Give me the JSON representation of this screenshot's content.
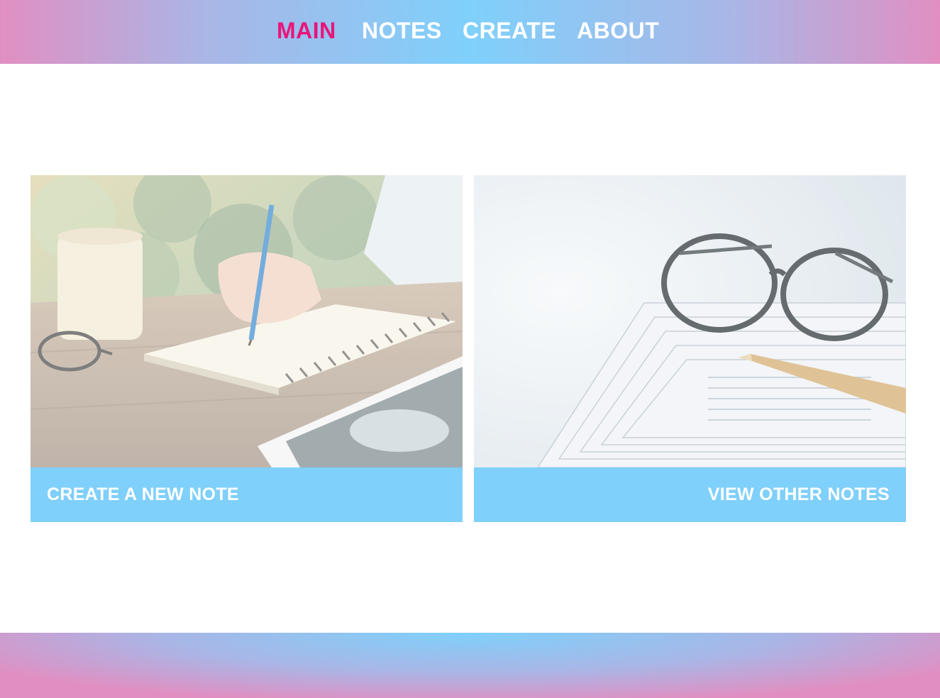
{
  "nav": {
    "items": [
      {
        "label": "MAIN",
        "active": true
      },
      {
        "label": "NOTES",
        "active": false
      },
      {
        "label": "CREATE",
        "active": false
      },
      {
        "label": "ABOUT",
        "active": false
      }
    ],
    "active_color": "#e8157a"
  },
  "cards": [
    {
      "label": "CREATE A NEW NOTE",
      "image": "writing-notebook-photo"
    },
    {
      "label": "VIEW OTHER NOTES",
      "image": "glasses-papers-photo"
    }
  ],
  "colors": {
    "accent_blue": "#7fd0fb",
    "pink": "#e18fc2",
    "lavender": "#a9b6e6"
  }
}
